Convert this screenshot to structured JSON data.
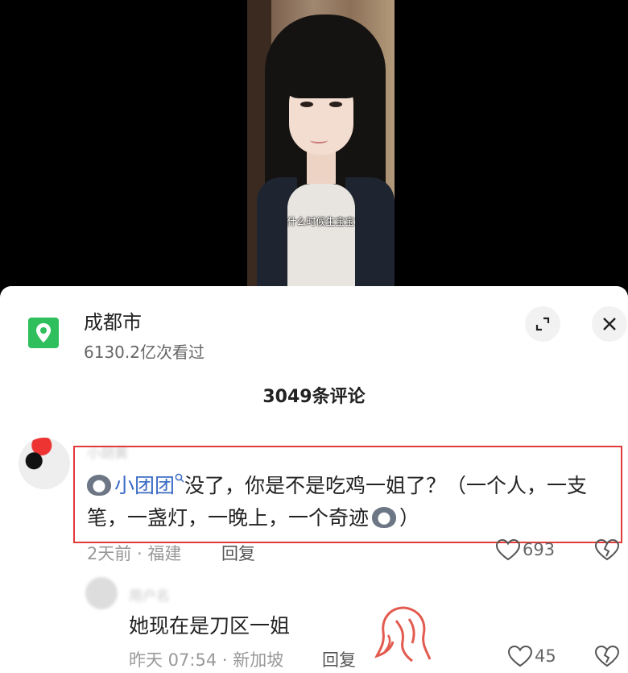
{
  "video": {
    "subtitle": "什么时候生宝宝"
  },
  "location": {
    "icon": "map-pin-icon",
    "title": "成都市",
    "views": "6130.2亿次看过"
  },
  "comments_header": {
    "count_label": "3049条评论"
  },
  "comments": [
    {
      "user": "小胡黄",
      "mention": "小团团",
      "text_part1": "没了，你是不是吃鸡一姐了？（一个人，一支笔，一盏灯，一晚上，一个奇迹",
      "text_part2": "）",
      "meta": "2天前 · 福建",
      "reply_label": "回复",
      "likes": "693"
    },
    {
      "user": "用户名",
      "text": "她现在是刀区一姐",
      "meta": "昨天 07:54 · 新加坡",
      "reply_label": "回复",
      "likes": "45"
    }
  ],
  "colors": {
    "location_icon": "#2fbf5c",
    "mention": "#3a6bc4",
    "highlight_box": "#e23a3a",
    "watermark": "#e35a4f"
  }
}
